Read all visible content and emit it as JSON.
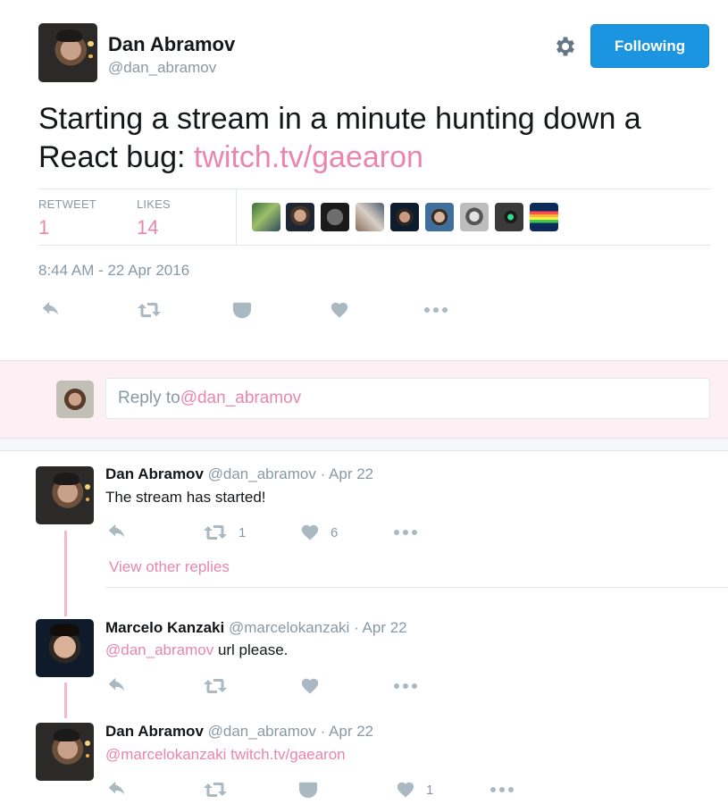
{
  "tweet": {
    "author_name": "Dan Abramov",
    "author_handle": "@dan_abramov",
    "follow_label": "Following",
    "text_before": "Starting a stream in a minute hunting down a React bug: ",
    "text_link": "twitch.tv/gaearon",
    "stats": {
      "retweet_label": "RETWEET",
      "retweet_count": "1",
      "likes_label": "LIKES",
      "likes_count": "14"
    },
    "timestamp": "8:44 AM - 22 Apr 2016"
  },
  "reply_box": {
    "prefix": "Reply to ",
    "mention": "@dan_abramov"
  },
  "replies": [
    {
      "name": "Dan Abramov",
      "handle": "@dan_abramov",
      "date": "· Apr 22",
      "text": "The stream has started!",
      "retweets": "1",
      "likes": "6"
    },
    {
      "name": "Marcelo Kanzaki",
      "handle": "@marcelokanzaki",
      "date": "· Apr 22",
      "mention": "@dan_abramov",
      "text": " url please."
    },
    {
      "name": "Dan Abramov",
      "handle": "@dan_abramov",
      "date": "· Apr 22",
      "mention": "@marcelokanzaki",
      "link": "twitch.tv/gaearon",
      "likes": "1"
    }
  ],
  "view_other_replies": "View other replies",
  "colors": {
    "accent_pink": "#ea85ad",
    "follow_blue": "#1b95e0",
    "muted": "#8899a6",
    "icon_grey": "#aab8c2",
    "thread_line": "#f7b6cf"
  },
  "icons": [
    "gear-icon",
    "reply-icon",
    "retweet-icon",
    "pocket-icon",
    "heart-icon",
    "more-icon"
  ]
}
